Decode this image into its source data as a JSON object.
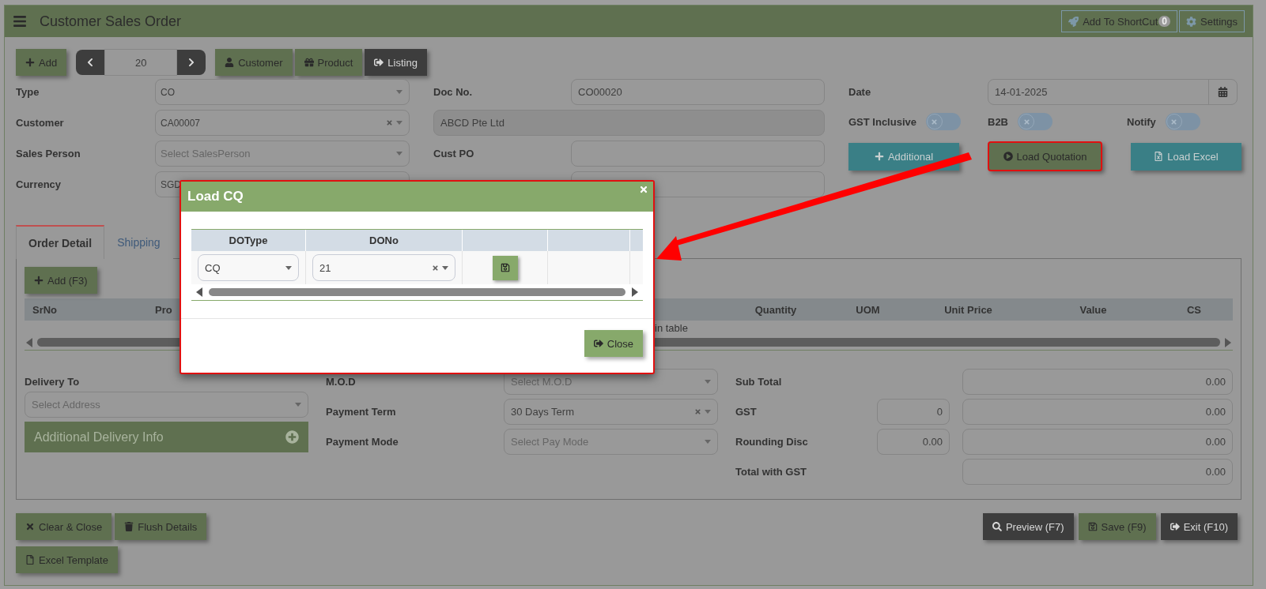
{
  "header": {
    "title": "Customer Sales Order",
    "shortcut_button": "Add To ShortCut",
    "shortcut_count": "0",
    "settings_button": "Settings"
  },
  "toolbar": {
    "add_button": "Add",
    "pager_value": "20",
    "buttons": [
      {
        "label": "Customer",
        "kind": "green"
      },
      {
        "label": "Product",
        "kind": "green"
      },
      {
        "label": "Listing",
        "kind": "dark"
      }
    ]
  },
  "form": {
    "column_1": [
      {
        "label": "Type",
        "value": "CO",
        "clearable": false
      },
      {
        "label": "Customer",
        "value": "CA00007",
        "clearable": true
      },
      {
        "label": "Sales Person",
        "placeholder": "Select SalesPerson",
        "clearable": false
      },
      {
        "label": "Currency",
        "value": "SGD"
      }
    ],
    "column_2": [
      {
        "label": "Doc No.",
        "kind": "input",
        "value": "CO00020"
      },
      {
        "kind": "readonly",
        "value": "ABCD Pte Ltd"
      },
      {
        "label": "Cust PO",
        "kind": "input"
      },
      {
        "kind": "input"
      }
    ],
    "date": {
      "label": "Date",
      "value": "14-01-2025"
    },
    "toggles": [
      {
        "label": "GST Inclusive",
        "on": false
      },
      {
        "label": "B2B",
        "on": false
      },
      {
        "label": "Notify",
        "on": false
      }
    ],
    "buttons": [
      {
        "label": "Additional",
        "highlighted": false
      },
      {
        "label": "Load Quotation",
        "highlighted": true
      },
      {
        "label": "Load Excel",
        "highlighted": false
      }
    ]
  },
  "tabs": [
    {
      "label": "Order Detail",
      "selected": true
    },
    {
      "label": "Shipping",
      "selected": false
    }
  ],
  "order_detail": {
    "add_button": "Add (F3)",
    "table": {
      "columns": [
        "SrNo",
        "Pro",
        "Quantity",
        "UOM",
        "Unit Price",
        "Value",
        "CS"
      ],
      "empty_message": "in table"
    },
    "delivery": {
      "label": "Delivery To",
      "placeholder": "Select Address",
      "info_bar": "Additional Delivery Info"
    },
    "fields": [
      {
        "label": "M.O.D",
        "placeholder": "Select M.O.D",
        "clearable": false
      },
      {
        "label": "Payment Term",
        "value": "30 Days Term",
        "clearable": true
      },
      {
        "label": "Payment Mode",
        "placeholder": "Select Pay Mode",
        "clearable": false
      }
    ],
    "totals": [
      {
        "label": "Sub Total",
        "value": "0.00"
      },
      {
        "label": "GST",
        "rate": "0",
        "value": "0.00"
      },
      {
        "label": "Rounding Disc",
        "rate": "0.00",
        "value": "0.00"
      },
      {
        "label": "Total with GST",
        "value": "0.00"
      }
    ]
  },
  "footer": {
    "left_buttons": [
      "Clear & Close",
      "Flush Details",
      "Excel Template"
    ],
    "right_buttons": [
      {
        "label": "Preview (F7)",
        "kind": "dark"
      },
      {
        "label": "Save (F9)",
        "kind": "green"
      },
      {
        "label": "Exit (F10)",
        "kind": "dark"
      }
    ]
  },
  "modal": {
    "title": "Load CQ",
    "columns": [
      "DOType",
      "DONo"
    ],
    "row": {
      "do_type": "CQ",
      "do_no": "21"
    },
    "close_button": "Close"
  }
}
